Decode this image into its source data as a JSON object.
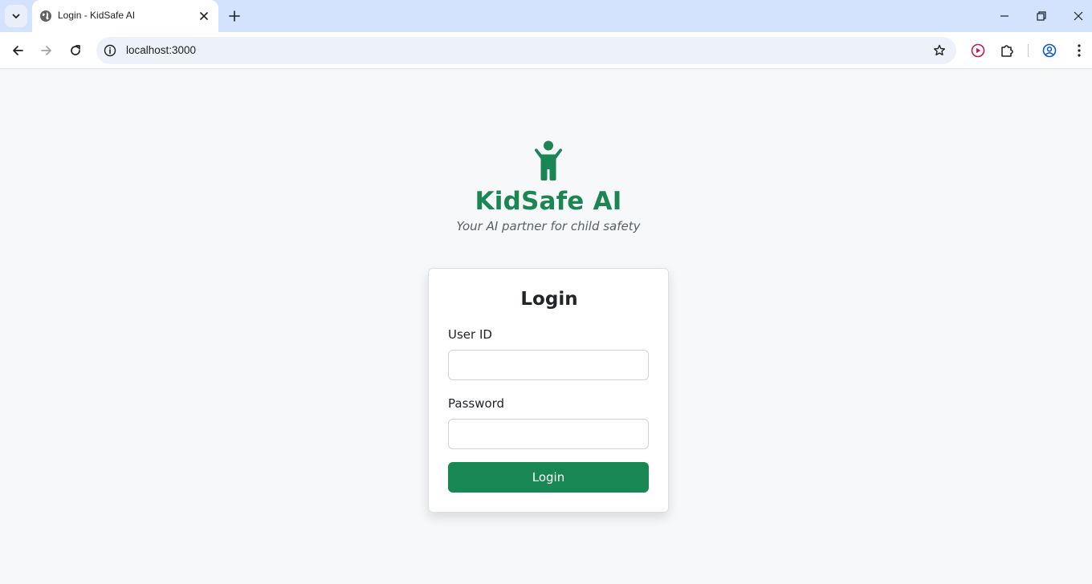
{
  "browser": {
    "tab": {
      "title": "Login - KidSafe AI",
      "favicon": "globe-icon"
    },
    "address_bar": {
      "url": "localhost:3000"
    },
    "icons": {
      "tab_menu": "chevron-down-icon",
      "tab_close": "close-icon",
      "new_tab": "plus-icon",
      "minimize": "minimize-icon",
      "restore": "restore-icon",
      "close_window": "close-icon",
      "back": "arrow-left-icon",
      "forward": "arrow-right-icon",
      "reload": "reload-icon",
      "site_info": "info-icon",
      "bookmark": "star-icon",
      "extension_record": "record-icon",
      "extensions": "puzzle-icon",
      "profile": "profile-icon",
      "menu": "kebab-menu-icon"
    }
  },
  "brand": {
    "icon": "child-icon",
    "name": "KidSafe AI",
    "tagline": "Your AI partner for child safety"
  },
  "login_form": {
    "title": "Login",
    "user_id": {
      "label": "User ID",
      "value": "",
      "placeholder": ""
    },
    "password": {
      "label": "Password",
      "value": "",
      "placeholder": ""
    },
    "submit_label": "Login"
  },
  "colors": {
    "brand_green": "#1b8553",
    "button_green": "#198754",
    "page_background": "#f7f8fa",
    "tabstrip_background": "#d3e3fd"
  }
}
